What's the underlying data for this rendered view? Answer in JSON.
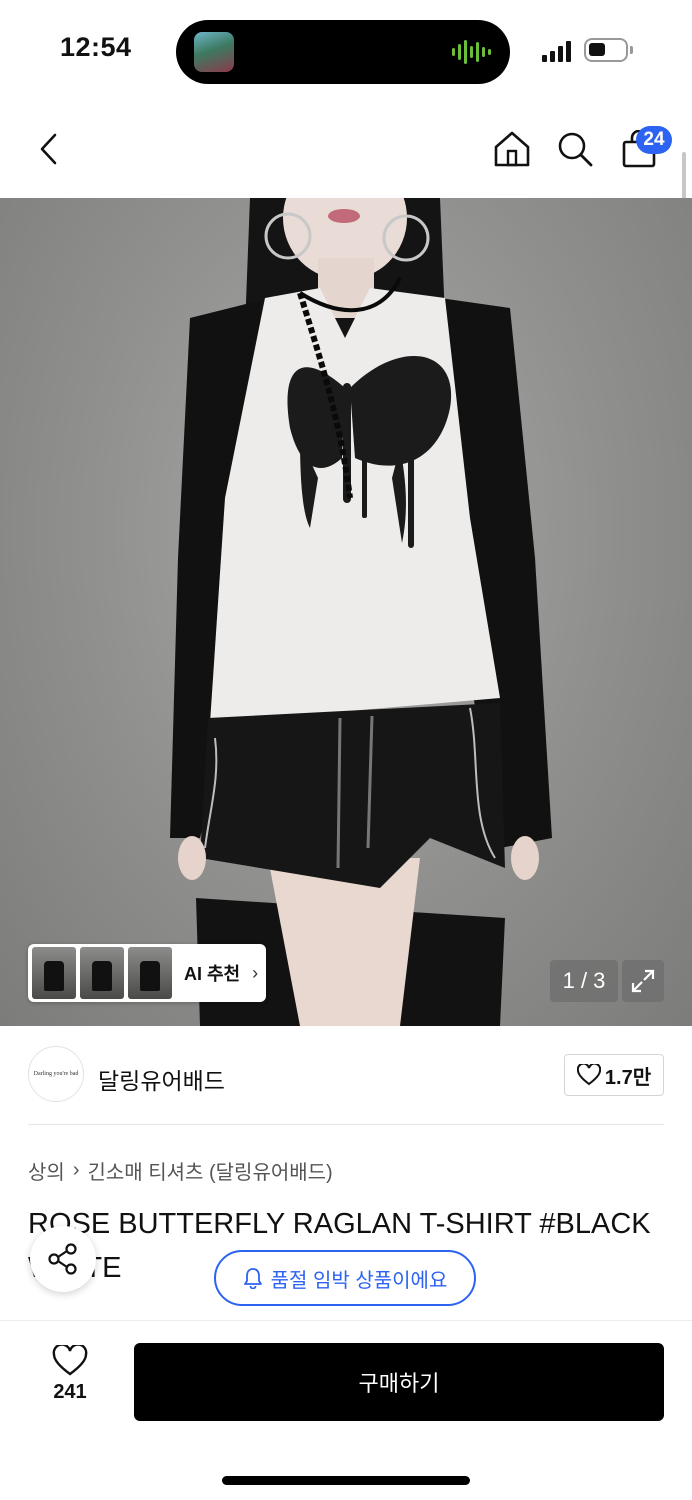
{
  "status_bar": {
    "time": "12:54"
  },
  "nav": {
    "cart_count": "24"
  },
  "hero": {
    "page_counter": "1 / 3",
    "ai_card_label": "AI 추천"
  },
  "brand": {
    "logo_text": "Darling you're bad",
    "name": "달링유어배드",
    "likes": "1.7만"
  },
  "breadcrumb": {
    "category": "상의",
    "subcategory": "긴소매 티셔츠 (달링유어배드)"
  },
  "product": {
    "title": "ROSE BUTTERFLY RAGLAN T-SHIRT #BLACK WHITE"
  },
  "restock": {
    "label": "품절 임박 상품이에요"
  },
  "bottom_bar": {
    "wish_count": "241",
    "buy_label": "구매하기"
  },
  "colors": {
    "accent_blue": "#2d63f2",
    "buy_button": "#000000"
  }
}
